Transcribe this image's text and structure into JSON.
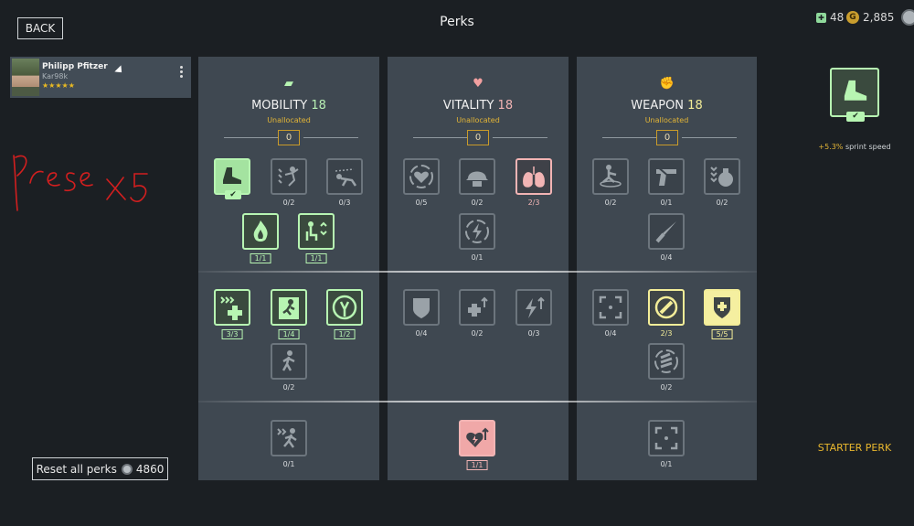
{
  "header": {
    "back_label": "BACK",
    "title": "Perks"
  },
  "currency": {
    "gems": "48",
    "gold": "2,885"
  },
  "soldier": {
    "name": "Philipp Pfitzer",
    "weapon": "Kar98k",
    "stars": "★★★★★"
  },
  "annotation": {
    "handwriting": "Prese × 5"
  },
  "reset": {
    "label": "Reset all perks",
    "cost": "4860"
  },
  "panels": [
    {
      "name": "MOBILITY",
      "points": "18",
      "status": "Unallocated",
      "allocated": "0",
      "icon": "sprint-icon",
      "color": "#b7f5b2"
    },
    {
      "name": "VITALITY",
      "points": "18",
      "status": "Unallocated",
      "allocated": "0",
      "icon": "heartbeat-icon",
      "color": "#f2b4b4"
    },
    {
      "name": "WEAPON",
      "points": "18",
      "status": "Unallocated",
      "allocated": "0",
      "icon": "fist-icon",
      "color": "#f3ed98"
    }
  ],
  "perks": {
    "mobility": [
      {
        "id": "sprint-speed",
        "count": "",
        "state": "selected",
        "icon": "boot-icon"
      },
      {
        "id": "jump",
        "count": "0/2",
        "state": "locked",
        "icon": "jump-icon"
      },
      {
        "id": "crawl",
        "count": "0/3",
        "state": "locked",
        "icon": "crawl-icon"
      },
      {
        "id": "fire-resist",
        "count": "1/1",
        "state": "active",
        "icon": "fire-icon"
      },
      {
        "id": "stance",
        "count": "1/1",
        "state": "active",
        "icon": "stance-icon"
      },
      {
        "id": "medic-speed",
        "count": "3/3",
        "state": "active",
        "icon": "medic-speed-icon"
      },
      {
        "id": "climb",
        "count": "1/4",
        "state": "active",
        "icon": "climb-icon"
      },
      {
        "id": "stamina",
        "count": "1/2",
        "state": "active",
        "icon": "stamina-icon"
      },
      {
        "id": "walk",
        "count": "0/2",
        "state": "locked",
        "icon": "walk-icon"
      },
      {
        "id": "starter-run",
        "count": "0/1",
        "state": "locked",
        "icon": "run-icon"
      }
    ],
    "vitality": [
      {
        "id": "heart-regen",
        "count": "0/5",
        "state": "locked",
        "icon": "heart-cycle-icon"
      },
      {
        "id": "helmet",
        "count": "0/2",
        "state": "locked",
        "icon": "helmet-icon"
      },
      {
        "id": "lungs",
        "count": "2/3",
        "state": "vital",
        "icon": "lungs-icon"
      },
      {
        "id": "energy-cycle",
        "count": "0/1",
        "state": "locked",
        "icon": "energy-cycle-icon"
      },
      {
        "id": "shield",
        "count": "0/4",
        "state": "locked",
        "icon": "shield-icon"
      },
      {
        "id": "heal-up",
        "count": "0/2",
        "state": "locked",
        "icon": "heal-up-icon"
      },
      {
        "id": "energy-up",
        "count": "0/3",
        "state": "locked",
        "icon": "energy-up-icon"
      },
      {
        "id": "starter-heart",
        "count": "1/1",
        "state": "vitalf",
        "icon": "heart-up-icon"
      }
    ],
    "weapon": [
      {
        "id": "vault",
        "count": "0/2",
        "state": "locked",
        "icon": "vault-icon"
      },
      {
        "id": "pistol",
        "count": "0/1",
        "state": "locked",
        "icon": "pistol-icon"
      },
      {
        "id": "grenade",
        "count": "0/2",
        "state": "locked",
        "icon": "grenade-icon"
      },
      {
        "id": "knife",
        "count": "0/4",
        "state": "locked",
        "icon": "knife-icon"
      },
      {
        "id": "aim",
        "count": "0/4",
        "state": "locked",
        "icon": "aim-icon"
      },
      {
        "id": "reload",
        "count": "2/3",
        "state": "weap",
        "icon": "reload-icon"
      },
      {
        "id": "ammo",
        "count": "5/5",
        "state": "weapf",
        "icon": "ammo-shield-icon"
      },
      {
        "id": "ammo-belt",
        "count": "0/2",
        "state": "locked",
        "icon": "ammo-belt-icon"
      },
      {
        "id": "starter-aim",
        "count": "0/1",
        "state": "locked",
        "icon": "aim-icon"
      }
    ]
  },
  "detail": {
    "value": "+5.3%",
    "text": "sprint speed",
    "footer": "STARTER PERK"
  }
}
